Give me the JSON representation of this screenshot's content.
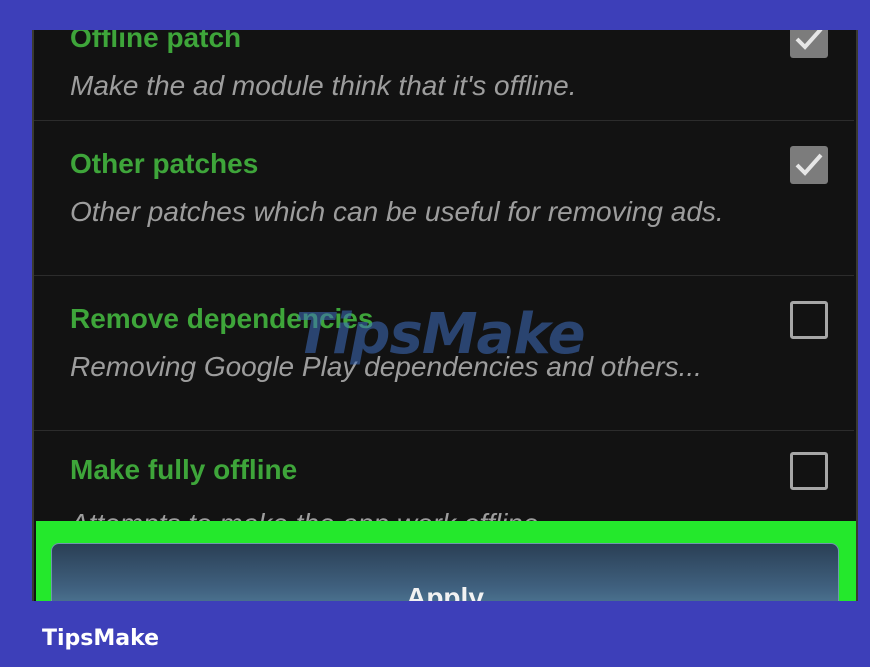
{
  "options": [
    {
      "title": "Offline patch",
      "description": "Make the ad module think that it's offline.",
      "checked": true
    },
    {
      "title": "Other patches",
      "description": "Other patches which can be useful for removing ads.",
      "checked": true
    },
    {
      "title": "Remove dependencies",
      "description": "Removing Google Play dependencies and others...",
      "checked": false
    },
    {
      "title": "Make fully offline",
      "description": "Attempts to make the app work offline",
      "checked": false
    }
  ],
  "apply_label": "Apply",
  "watermark": "TipsMake",
  "footer_brand": "TipsMake",
  "colors": {
    "background": "#3d3fb9",
    "title_green": "#3ea53a",
    "highlight_green": "#24e82c"
  }
}
